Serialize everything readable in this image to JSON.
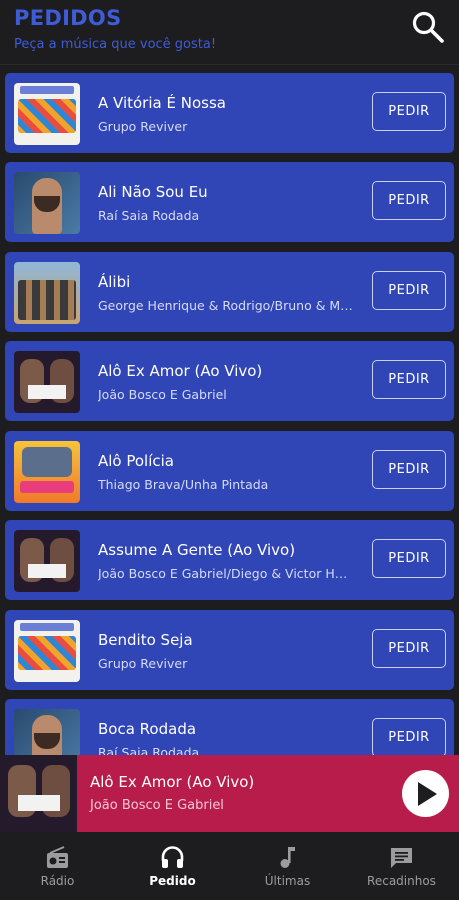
{
  "header": {
    "title": "PEDIDOS",
    "subtitle": "Peça a música que você gosta!"
  },
  "request_label": "PEDIR",
  "songs": [
    {
      "title": "A Vitória É Nossa",
      "artist": "Grupo Reviver",
      "art": "a1"
    },
    {
      "title": "Ali Não Sou Eu",
      "artist": "Raí Saia Rodada",
      "art": "a2"
    },
    {
      "title": "Álibi",
      "artist": "George Henrique & Rodrigo/Bruno & Marrone",
      "art": "a3"
    },
    {
      "title": "Alô Ex Amor (Ao Vivo)",
      "artist": "João Bosco E Gabriel",
      "art": "a4"
    },
    {
      "title": "Alô Polícia",
      "artist": "Thiago Brava/Unha Pintada",
      "art": "a5"
    },
    {
      "title": "Assume A Gente (Ao Vivo)",
      "artist": "João Bosco E Gabriel/Diego & Victor Hugo",
      "art": "a4"
    },
    {
      "title": "Bendito Seja",
      "artist": "Grupo Reviver",
      "art": "a1"
    },
    {
      "title": "Boca Rodada",
      "artist": "Raí Saia Rodada",
      "art": "a2"
    }
  ],
  "now_playing": {
    "title": "Alô Ex Amor (Ao Vivo)",
    "artist": "João Bosco E Gabriel"
  },
  "nav": {
    "radio": "Rádio",
    "pedido": "Pedido",
    "ultimas": "Últimas",
    "recadinhos": "Recadinhos"
  },
  "colors": {
    "accent": "#3f5bd6",
    "row": "#3045b6",
    "player": "#b81c4a"
  }
}
